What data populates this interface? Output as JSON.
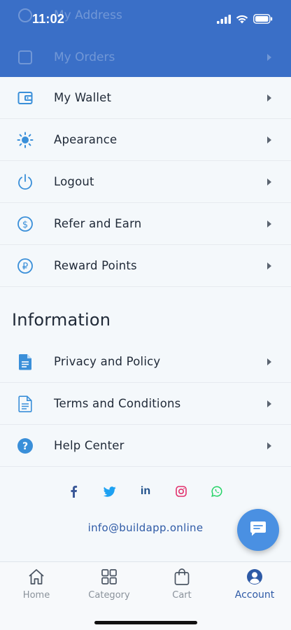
{
  "status_bar": {
    "time": "11:02",
    "icons": [
      "signal-icon",
      "wifi-icon",
      "battery-icon"
    ]
  },
  "scrolled_under_header": [
    {
      "label": "My Address",
      "icon": "location-icon"
    },
    {
      "label": "My Orders",
      "icon": "orders-icon"
    }
  ],
  "account_menu": [
    {
      "label": "My Wallet",
      "icon": "wallet-icon"
    },
    {
      "label": "Apearance",
      "icon": "sun-icon"
    },
    {
      "label": "Logout",
      "icon": "power-icon"
    },
    {
      "label": "Refer and Earn",
      "icon": "dollar-circle-icon"
    },
    {
      "label": "Reward Points",
      "icon": "ruble-circle-icon"
    }
  ],
  "information": {
    "title": "Information",
    "items": [
      {
        "label": "Privacy and Policy",
        "icon": "document-filled-icon"
      },
      {
        "label": "Terms and Conditions",
        "icon": "document-outline-icon"
      },
      {
        "label": "Help Center",
        "icon": "help-circle-icon"
      }
    ]
  },
  "social_links": [
    {
      "name": "facebook-icon",
      "color": "#3b5998"
    },
    {
      "name": "twitter-icon",
      "color": "#1da1f2"
    },
    {
      "name": "linkedin-icon",
      "color": "#1e4f8a"
    },
    {
      "name": "instagram-icon",
      "color": "#e1306c"
    },
    {
      "name": "whatsapp-icon",
      "color": "#25d366"
    }
  ],
  "contact_email": "info@buildapp.online",
  "tabbar": {
    "tabs": [
      {
        "label": "Home",
        "icon": "home-icon",
        "active": false
      },
      {
        "label": "Category",
        "icon": "grid-icon",
        "active": false
      },
      {
        "label": "Cart",
        "icon": "bag-icon",
        "active": false
      },
      {
        "label": "Account",
        "icon": "user-icon",
        "active": true
      }
    ]
  },
  "colors": {
    "header": "#3a6fc7",
    "accent": "#3a8fd9",
    "fab": "#4a90e2",
    "active_tab": "#2e5aa6"
  }
}
